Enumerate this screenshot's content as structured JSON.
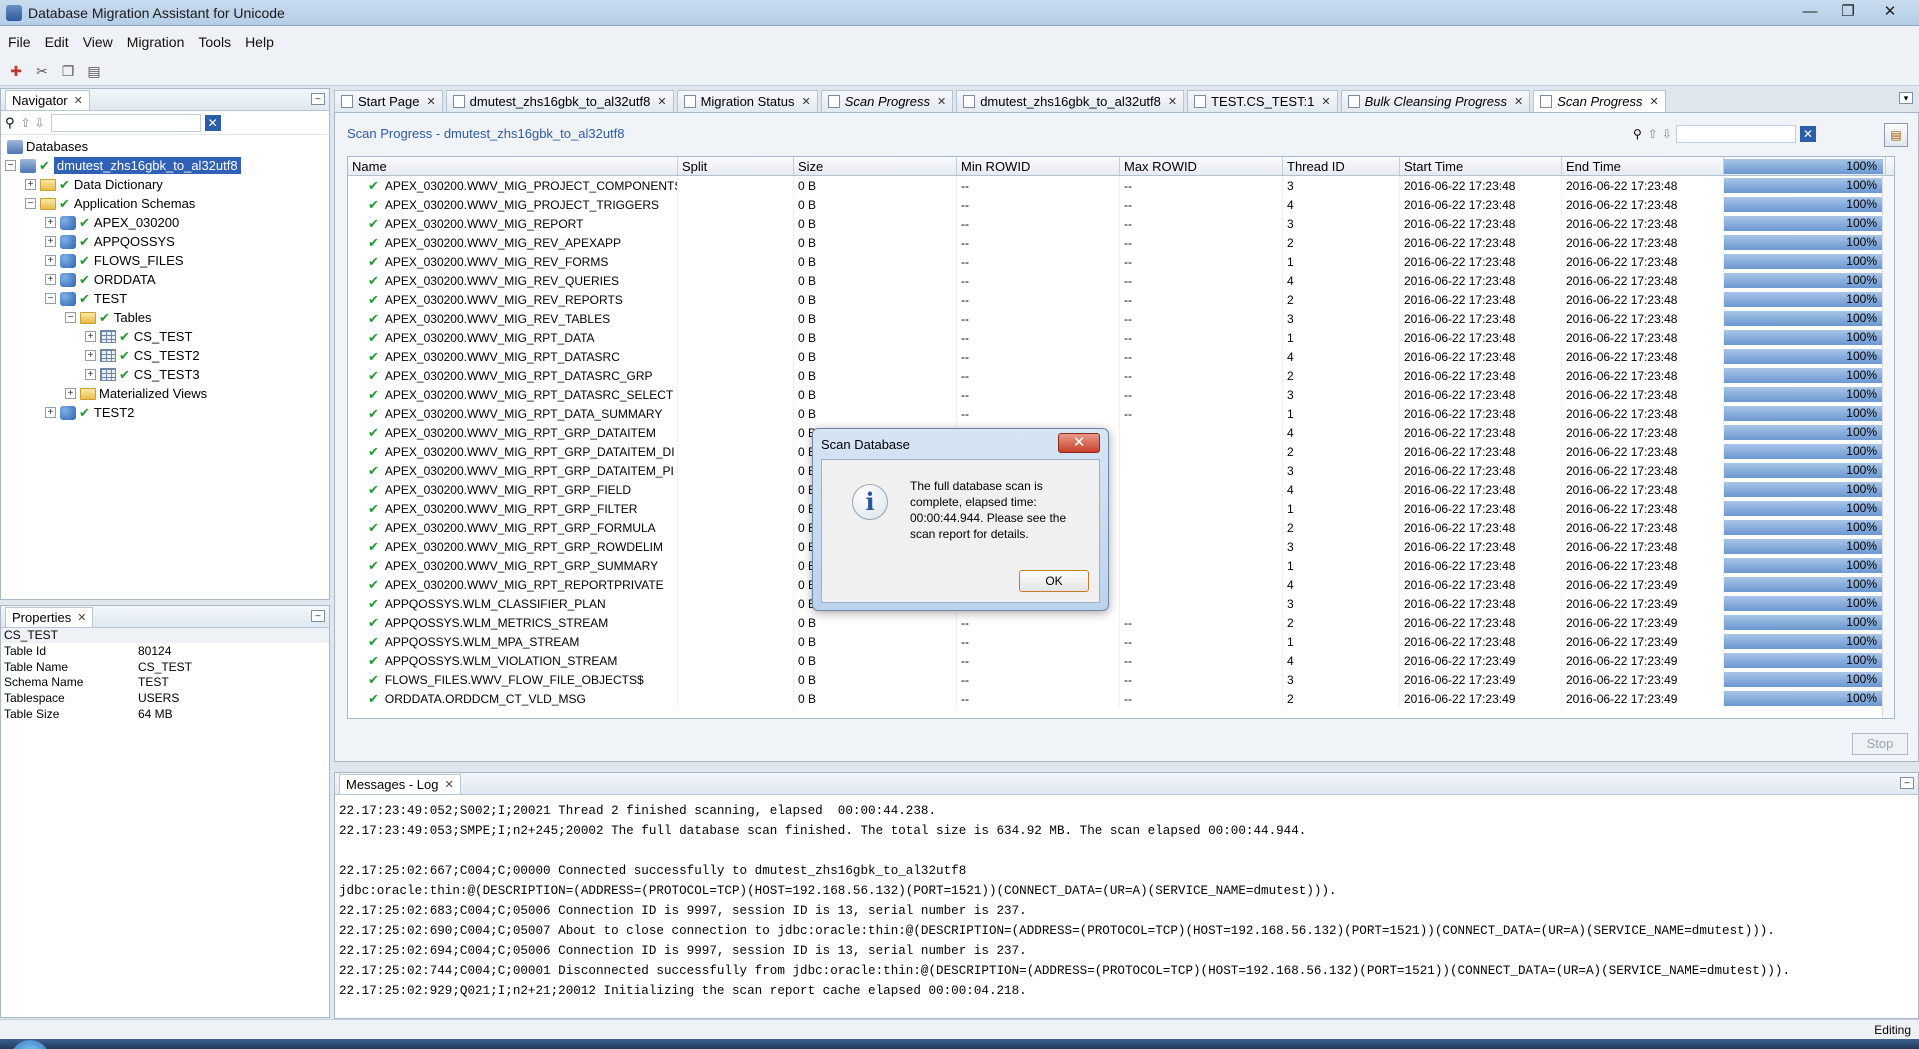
{
  "window": {
    "title": "Database Migration Assistant for Unicode",
    "min": "—",
    "max": "❐",
    "close": "✕"
  },
  "menu": [
    "File",
    "Edit",
    "View",
    "Migration",
    "Tools",
    "Help"
  ],
  "navigator": {
    "tab": "Navigator",
    "tree": {
      "databases": "Databases",
      "connection": "dmutest_zhs16gbk_to_al32utf8",
      "data_dictionary": "Data Dictionary",
      "application_schemas": "Application Schemas",
      "schemas": [
        "APEX_030200",
        "APPQOSSYS",
        "FLOWS_FILES",
        "ORDDATA",
        "TEST"
      ],
      "tables": "Tables",
      "table_items": [
        "CS_TEST",
        "CS_TEST2",
        "CS_TEST3"
      ],
      "materialized_views": "Materialized Views",
      "test2": "TEST2"
    }
  },
  "properties": {
    "tab": "Properties",
    "object": "CS_TEST",
    "rows": [
      {
        "k": "Table Id",
        "v": "80124"
      },
      {
        "k": "Table Name",
        "v": "CS_TEST"
      },
      {
        "k": "Schema Name",
        "v": "TEST"
      },
      {
        "k": "Tablespace",
        "v": "USERS"
      },
      {
        "k": "Table Size",
        "v": "64 MB"
      }
    ]
  },
  "tabs": [
    {
      "label": "Start Page",
      "italic": false
    },
    {
      "label": "dmutest_zhs16gbk_to_al32utf8",
      "italic": false
    },
    {
      "label": "Migration Status",
      "italic": false
    },
    {
      "label": "Scan Progress",
      "italic": true
    },
    {
      "label": "dmutest_zhs16gbk_to_al32utf8",
      "italic": false
    },
    {
      "label": "TEST.CS_TEST:1",
      "italic": false
    },
    {
      "label": "Bulk Cleansing Progress",
      "italic": true
    },
    {
      "label": "Scan Progress",
      "italic": true
    }
  ],
  "scan": {
    "title": "Scan Progress - dmutest_zhs16gbk_to_al32utf8",
    "columns": [
      "Name",
      "Split",
      "Size",
      "Min ROWID",
      "Max ROWID",
      "Thread ID",
      "Start Time",
      "End Time",
      "100%"
    ],
    "rows": [
      [
        "APEX_030200.WWV_MIG_PROJECT_COMPONENTS",
        "",
        "0 B",
        "--",
        "--",
        "3",
        "2016-06-22 17:23:48",
        "2016-06-22 17:23:48",
        "100%"
      ],
      [
        "APEX_030200.WWV_MIG_PROJECT_TRIGGERS",
        "",
        "0 B",
        "--",
        "--",
        "4",
        "2016-06-22 17:23:48",
        "2016-06-22 17:23:48",
        "100%"
      ],
      [
        "APEX_030200.WWV_MIG_REPORT",
        "",
        "0 B",
        "--",
        "--",
        "3",
        "2016-06-22 17:23:48",
        "2016-06-22 17:23:48",
        "100%"
      ],
      [
        "APEX_030200.WWV_MIG_REV_APEXAPP",
        "",
        "0 B",
        "--",
        "--",
        "2",
        "2016-06-22 17:23:48",
        "2016-06-22 17:23:48",
        "100%"
      ],
      [
        "APEX_030200.WWV_MIG_REV_FORMS",
        "",
        "0 B",
        "--",
        "--",
        "1",
        "2016-06-22 17:23:48",
        "2016-06-22 17:23:48",
        "100%"
      ],
      [
        "APEX_030200.WWV_MIG_REV_QUERIES",
        "",
        "0 B",
        "--",
        "--",
        "4",
        "2016-06-22 17:23:48",
        "2016-06-22 17:23:48",
        "100%"
      ],
      [
        "APEX_030200.WWV_MIG_REV_REPORTS",
        "",
        "0 B",
        "--",
        "--",
        "2",
        "2016-06-22 17:23:48",
        "2016-06-22 17:23:48",
        "100%"
      ],
      [
        "APEX_030200.WWV_MIG_REV_TABLES",
        "",
        "0 B",
        "--",
        "--",
        "3",
        "2016-06-22 17:23:48",
        "2016-06-22 17:23:48",
        "100%"
      ],
      [
        "APEX_030200.WWV_MIG_RPT_DATA",
        "",
        "0 B",
        "--",
        "--",
        "1",
        "2016-06-22 17:23:48",
        "2016-06-22 17:23:48",
        "100%"
      ],
      [
        "APEX_030200.WWV_MIG_RPT_DATASRC",
        "",
        "0 B",
        "--",
        "--",
        "4",
        "2016-06-22 17:23:48",
        "2016-06-22 17:23:48",
        "100%"
      ],
      [
        "APEX_030200.WWV_MIG_RPT_DATASRC_GRP",
        "",
        "0 B",
        "--",
        "--",
        "2",
        "2016-06-22 17:23:48",
        "2016-06-22 17:23:48",
        "100%"
      ],
      [
        "APEX_030200.WWV_MIG_RPT_DATASRC_SELECT",
        "",
        "0 B",
        "--",
        "--",
        "3",
        "2016-06-22 17:23:48",
        "2016-06-22 17:23:48",
        "100%"
      ],
      [
        "APEX_030200.WWV_MIG_RPT_DATA_SUMMARY",
        "",
        "0 B",
        "--",
        "--",
        "1",
        "2016-06-22 17:23:48",
        "2016-06-22 17:23:48",
        "100%"
      ],
      [
        "APEX_030200.WWV_MIG_RPT_GRP_DATAITEM",
        "",
        "0 B",
        "",
        "",
        "4",
        "2016-06-22 17:23:48",
        "2016-06-22 17:23:48",
        "100%"
      ],
      [
        "APEX_030200.WWV_MIG_RPT_GRP_DATAITEM_DI",
        "",
        "0 B",
        "",
        "",
        "2",
        "2016-06-22 17:23:48",
        "2016-06-22 17:23:48",
        "100%"
      ],
      [
        "APEX_030200.WWV_MIG_RPT_GRP_DATAITEM_PI",
        "",
        "0 B",
        "",
        "",
        "3",
        "2016-06-22 17:23:48",
        "2016-06-22 17:23:48",
        "100%"
      ],
      [
        "APEX_030200.WWV_MIG_RPT_GRP_FIELD",
        "",
        "0 B",
        "",
        "",
        "4",
        "2016-06-22 17:23:48",
        "2016-06-22 17:23:48",
        "100%"
      ],
      [
        "APEX_030200.WWV_MIG_RPT_GRP_FILTER",
        "",
        "0 B",
        "",
        "",
        "1",
        "2016-06-22 17:23:48",
        "2016-06-22 17:23:48",
        "100%"
      ],
      [
        "APEX_030200.WWV_MIG_RPT_GRP_FORMULA",
        "",
        "0 B",
        "",
        "",
        "2",
        "2016-06-22 17:23:48",
        "2016-06-22 17:23:48",
        "100%"
      ],
      [
        "APEX_030200.WWV_MIG_RPT_GRP_ROWDELIM",
        "",
        "0 B",
        "",
        "",
        "3",
        "2016-06-22 17:23:48",
        "2016-06-22 17:23:48",
        "100%"
      ],
      [
        "APEX_030200.WWV_MIG_RPT_GRP_SUMMARY",
        "",
        "0 B",
        "",
        "",
        "1",
        "2016-06-22 17:23:48",
        "2016-06-22 17:23:48",
        "100%"
      ],
      [
        "APEX_030200.WWV_MIG_RPT_REPORTPRIVATE",
        "",
        "0 B",
        "",
        "",
        "4",
        "2016-06-22 17:23:48",
        "2016-06-22 17:23:49",
        "100%"
      ],
      [
        "APPQOSSYS.WLM_CLASSIFIER_PLAN",
        "",
        "0 B",
        "",
        "",
        "3",
        "2016-06-22 17:23:48",
        "2016-06-22 17:23:49",
        "100%"
      ],
      [
        "APPQOSSYS.WLM_METRICS_STREAM",
        "",
        "0 B",
        "--",
        "--",
        "2",
        "2016-06-22 17:23:48",
        "2016-06-22 17:23:49",
        "100%"
      ],
      [
        "APPQOSSYS.WLM_MPA_STREAM",
        "",
        "0 B",
        "--",
        "--",
        "1",
        "2016-06-22 17:23:48",
        "2016-06-22 17:23:49",
        "100%"
      ],
      [
        "APPQOSSYS.WLM_VIOLATION_STREAM",
        "",
        "0 B",
        "--",
        "--",
        "4",
        "2016-06-22 17:23:49",
        "2016-06-22 17:23:49",
        "100%"
      ],
      [
        "FLOWS_FILES.WWV_FLOW_FILE_OBJECTS$",
        "",
        "0 B",
        "--",
        "--",
        "3",
        "2016-06-22 17:23:49",
        "2016-06-22 17:23:49",
        "100%"
      ],
      [
        "ORDDATA.ORDDCM_CT_VLD_MSG",
        "",
        "0 B",
        "--",
        "--",
        "2",
        "2016-06-22 17:23:49",
        "2016-06-22 17:23:49",
        "100%"
      ]
    ],
    "stop": "Stop"
  },
  "messages": {
    "tab": "Messages - Log",
    "lines": [
      "22.17:23:49:052;S002;I;20021 Thread 2 finished scanning, elapsed  00:00:44.238.",
      "22.17:23:49:053;SMPE;I;n2+245;20002 The full database scan finished. The total size is 634.92 MB. The scan elapsed 00:00:44.944.",
      "",
      "22.17:25:02:667;C004;C;00000 Connected successfully to dmutest_zhs16gbk_to_al32utf8",
      "jdbc:oracle:thin:@(DESCRIPTION=(ADDRESS=(PROTOCOL=TCP)(HOST=192.168.56.132)(PORT=1521))(CONNECT_DATA=(UR=A)(SERVICE_NAME=dmutest))).",
      "22.17:25:02:683;C004;C;05006 Connection ID is 9997, session ID is 13, serial number is 237.",
      "22.17:25:02:690;C004;C;05007 About to close connection to jdbc:oracle:thin:@(DESCRIPTION=(ADDRESS=(PROTOCOL=TCP)(HOST=192.168.56.132)(PORT=1521))(CONNECT_DATA=(UR=A)(SERVICE_NAME=dmutest))).",
      "22.17:25:02:694;C004;C;05006 Connection ID is 9997, session ID is 13, serial number is 237.",
      "22.17:25:02:744;C004;C;00001 Disconnected successfully from jdbc:oracle:thin:@(DESCRIPTION=(ADDRESS=(PROTOCOL=TCP)(HOST=192.168.56.132)(PORT=1521))(CONNECT_DATA=(UR=A)(SERVICE_NAME=dmutest))).",
      "22.17:25:02:929;Q021;I;n2+21;20012 Initializing the scan report cache elapsed 00:00:04.218."
    ]
  },
  "dialog": {
    "title": "Scan Database",
    "message": "The full database scan is complete, elapsed time: 00:00:44.944. Please see the scan report for details.",
    "ok": "OK"
  },
  "status": "Editing"
}
